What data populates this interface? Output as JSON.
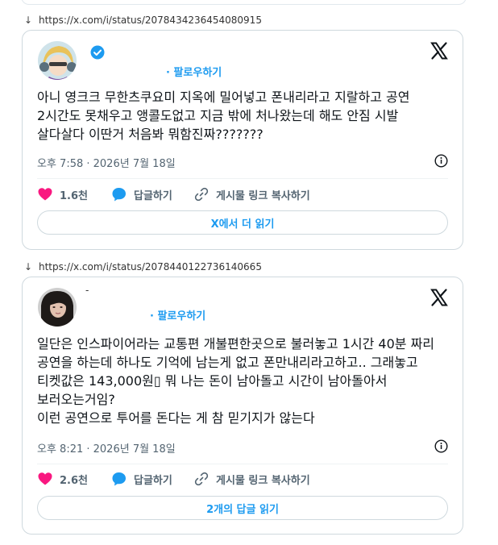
{
  "tweets": [
    {
      "url": "https://x.com/i/status/2078434236454080915",
      "follow_label": "· 팔로우하기",
      "name_mark": "-",
      "text": "아니 영크크 무한츠쿠요미 지옥에 밀어넣고 폰내리라고 지랄하고 공연 2시간도 못채우고 앵콜도없고 지금 밖에 처나왔는데 해도 안짐 시발 살다살다 이딴거 처음봐 뭐함진짜???????",
      "timestamp": "오후 7:58 · 2026년 7월 18일",
      "likes": "1.6천",
      "reply_label": "답글하기",
      "copy_label": "게시물 링크 복사하기",
      "read_more": "X에서 더 읽기"
    },
    {
      "url": "https://x.com/i/status/2078440122736140665",
      "follow_label": "· 팔로우하기",
      "name_mark": "-",
      "text": "일단은 인스파이어라는 교통편 개불편한곳으로 불러놓고 1시간 40분 짜리 공연을 하는데 하나도 기억에 남는게 없고 폰만내리라고하고.. 그래놓고 티켓값은 143,000원▯ 뭐 나는 돈이 남아돌고 시간이 남아돌아서 보러오는거임?\n이런 공연으로 투어를 돈다는 게 참 믿기지가 않는다",
      "timestamp": "오후 8:21 · 2026년 7월 18일",
      "likes": "2.6천",
      "reply_label": "답글하기",
      "copy_label": "게시물 링크 복사하기",
      "read_more": "2개의 답글 읽기"
    }
  ],
  "colors": {
    "accent": "#1d9bf0",
    "like": "#f91880",
    "muted": "#536471",
    "border": "#cfd9de"
  },
  "icons": [
    "download-arrow-icon",
    "verified-badge-icon",
    "x-logo-icon",
    "info-icon",
    "heart-icon",
    "reply-bubble-icon",
    "link-icon"
  ]
}
